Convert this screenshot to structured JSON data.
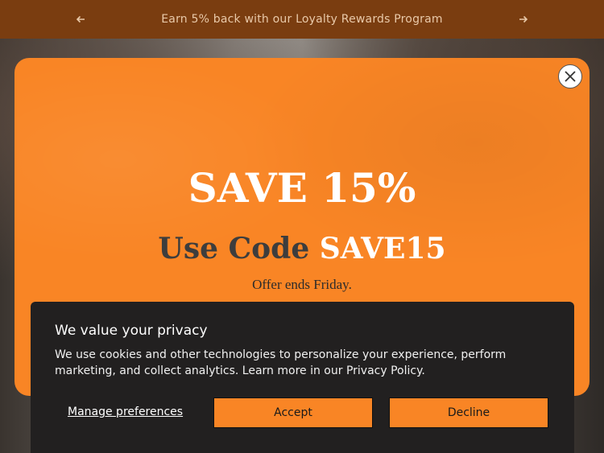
{
  "announcement": {
    "text": "Earn 5% back with our Loyalty Rewards Program",
    "prev_icon": "arrow-left-icon",
    "next_icon": "arrow-right-icon"
  },
  "popup": {
    "title": "SAVE 15%",
    "code_prefix": "Use Code ",
    "code": "SAVE15",
    "ends": "Offer ends Friday.",
    "close_icon": "close-icon"
  },
  "cookie_banner": {
    "title": "We value your privacy",
    "text": "We use cookies and other technologies to personalize your experience, perform marketing, and collect analytics. Learn more in our Privacy Policy.",
    "manage_label": "Manage preferences",
    "accept_label": "Accept",
    "decline_label": "Decline"
  },
  "colors": {
    "brand_orange": "#f98525",
    "announcement_bg": "#7a3d10",
    "banner_bg": "#222020"
  }
}
